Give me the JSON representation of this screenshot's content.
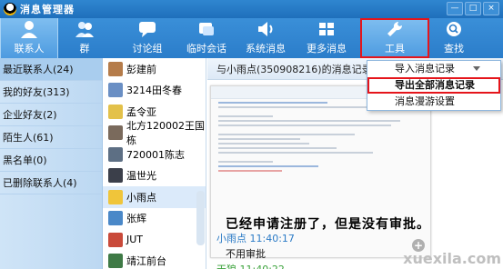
{
  "window": {
    "title": "消息管理器",
    "min": "—",
    "max": "□",
    "close": "×"
  },
  "toolbar": {
    "items": [
      {
        "label": "联系人",
        "icon": "person-icon"
      },
      {
        "label": "群",
        "icon": "group-icon"
      },
      {
        "label": "讨论组",
        "icon": "discussion-icon"
      },
      {
        "label": "临时会话",
        "icon": "temp-chat-icon"
      },
      {
        "label": "系统消息",
        "icon": "speaker-icon"
      },
      {
        "label": "更多消息",
        "icon": "more-messages-icon"
      },
      {
        "label": "工具",
        "icon": "wrench-icon"
      },
      {
        "label": "查找",
        "icon": "search-icon"
      }
    ]
  },
  "groups": [
    {
      "label": "最近联系人(24)"
    },
    {
      "label": "我的好友(313)"
    },
    {
      "label": "企业好友(2)"
    },
    {
      "label": "陌生人(61)"
    },
    {
      "label": "黑名单(0)"
    },
    {
      "label": "已删除联系人(4)"
    }
  ],
  "contacts": [
    {
      "name": "彭建前",
      "color": "#b57c4a"
    },
    {
      "name": "3214田冬春",
      "color": "#6a8fc4"
    },
    {
      "name": "孟令亚",
      "color": "#e3c14a"
    },
    {
      "name": "北方120002王国栋",
      "color": "#7a6a5c"
    },
    {
      "name": "720001陈志",
      "color": "#5d6f84"
    },
    {
      "name": "温世光",
      "color": "#3b3f4a"
    },
    {
      "name": "小雨点",
      "color": "#f0c53a"
    },
    {
      "name": "张辉",
      "color": "#4a88c8"
    },
    {
      "name": "JUT",
      "color": "#c94a3a"
    },
    {
      "name": "靖江前台",
      "color": "#3f7a46"
    }
  ],
  "chat": {
    "header": "与小雨点(350908216)的消息记录",
    "big_message": "已经申请注册了，但是没有审批。",
    "sender1": "小雨点 11:40:17",
    "text1": "不用审批",
    "sender2": "天狼 11:40:22"
  },
  "menu": {
    "items": [
      {
        "label": "导入消息记录"
      },
      {
        "label": "导出全部消息记录"
      },
      {
        "label": "消息漫游设置"
      }
    ]
  },
  "watermark": "xuexila.com"
}
